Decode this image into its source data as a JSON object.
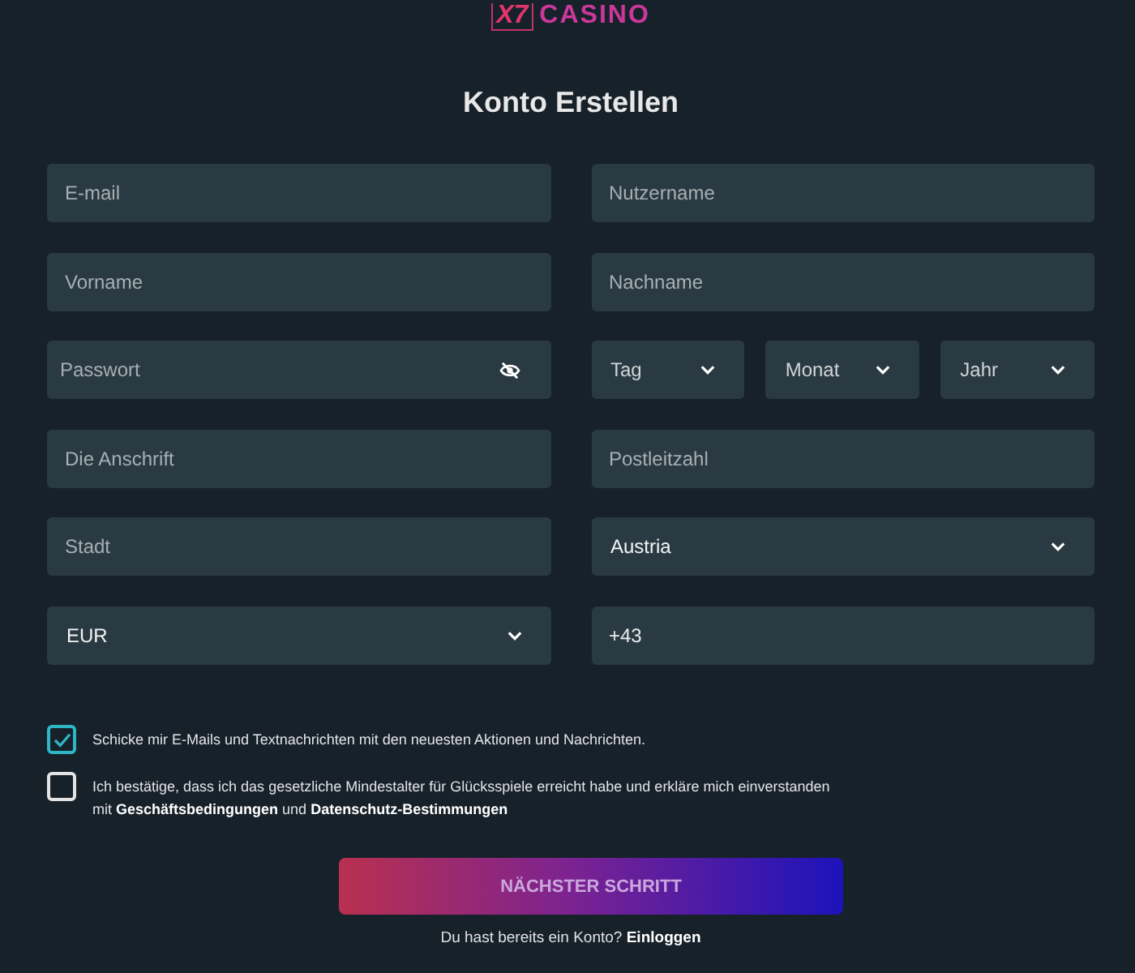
{
  "logo": {
    "badge": "X7",
    "text": "CASINO"
  },
  "title": "Konto Erstellen",
  "form": {
    "rows": [
      {
        "fields": [
          {
            "kind": "text",
            "placeholder": "E-mail"
          },
          {
            "kind": "text",
            "placeholder": "Nutzername"
          }
        ]
      },
      {
        "fields": [
          {
            "kind": "text",
            "placeholder": "Vorname"
          },
          {
            "kind": "text",
            "placeholder": "Nachname"
          }
        ]
      },
      {
        "fields": [
          {
            "kind": "password",
            "placeholder": "Passwort"
          },
          {
            "kind": "group",
            "fields": [
              {
                "kind": "select",
                "placeholder": "Tag"
              },
              {
                "kind": "select",
                "placeholder": "Monat"
              },
              {
                "kind": "select",
                "placeholder": "Jahr"
              }
            ]
          }
        ]
      },
      {
        "fields": [
          {
            "kind": "text",
            "placeholder": "Die Anschrift"
          },
          {
            "kind": "text",
            "placeholder": "Postleitzahl"
          }
        ]
      },
      {
        "fields": [
          {
            "kind": "text",
            "placeholder": "Stadt"
          },
          {
            "kind": "select",
            "value": "Austria"
          }
        ]
      },
      {
        "fields": [
          {
            "kind": "select",
            "value": "EUR"
          },
          {
            "kind": "text",
            "value": "+43"
          }
        ]
      }
    ]
  },
  "consents": [
    {
      "checked": true,
      "segments": [
        {
          "kind": "text",
          "text": "Schicke mir E-Mails und Textnachrichten mit den neuesten Aktionen und Nachrichten."
        }
      ]
    },
    {
      "checked": false,
      "segments": [
        {
          "kind": "text",
          "text": "Ich bestätige, dass ich das gesetzliche Mindestalter für Glücksspiele erreicht habe und erkläre mich einverstanden mit"
        },
        {
          "kind": "link",
          "text": "Geschäftsbedingungen"
        },
        {
          "kind": "text",
          "text": "und"
        },
        {
          "kind": "link",
          "text": "Datenschutz-Bestimmungen"
        }
      ]
    }
  ],
  "button": {
    "label": "NÄCHSTER SCHRITT"
  },
  "footer": {
    "text": "Du hast bereits ein Konto?",
    "link": "Einloggen"
  }
}
